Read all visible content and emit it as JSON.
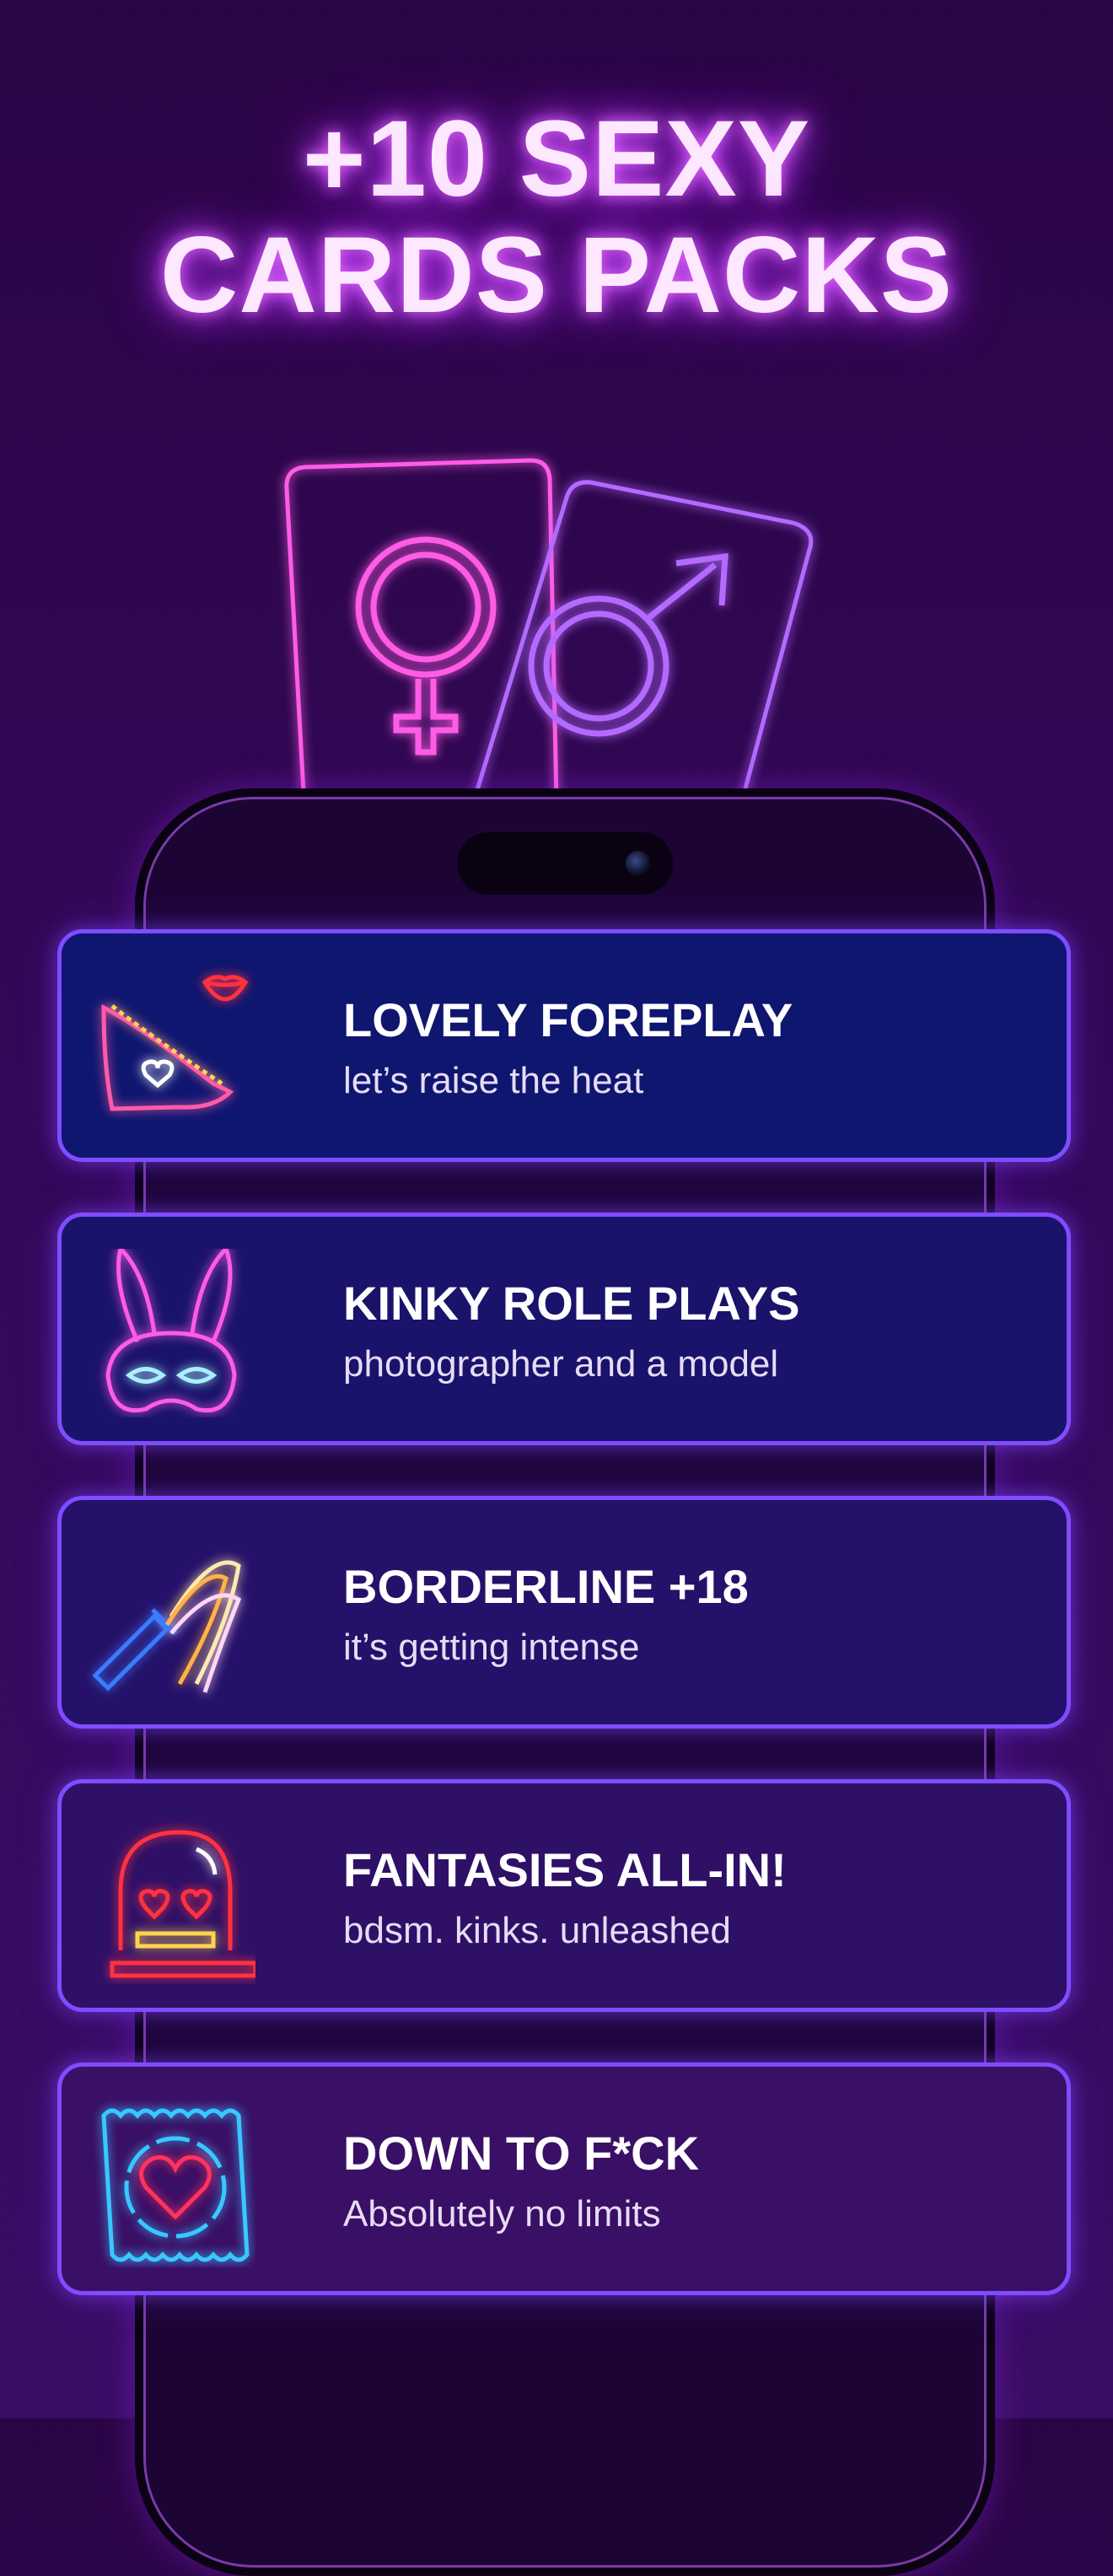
{
  "headline": {
    "line1": "+10 SEXY",
    "line2": "CARDS PACKS"
  },
  "hero": {
    "left_card_icon": "female-symbol-icon",
    "right_card_icon": "male-symbol-icon",
    "colors": {
      "pink": "#ff5be6",
      "violet": "#b46bff"
    }
  },
  "packs": [
    {
      "title": "LOVELY FOREPLAY",
      "subtitle": "let’s raise the heat",
      "icon": "panties-lips-icon",
      "bg": "#0f1670"
    },
    {
      "title": "KINKY ROLE PLAYS",
      "subtitle": "photographer and a model",
      "icon": "bunny-mask-icon",
      "bg": "#1a136b"
    },
    {
      "title": "BORDERLINE +18",
      "subtitle": "it’s getting intense",
      "icon": "whip-icon",
      "bg": "#25116a"
    },
    {
      "title": "FANTASIES ALL-IN!",
      "subtitle": "bdsm. kinks. unleashed",
      "icon": "in-love-ghost-icon",
      "bg": "#2e1067"
    },
    {
      "title": "DOWN TO F*CK",
      "subtitle": "Absolutely no limits",
      "icon": "condom-heart-icon",
      "bg": "#3a0f66"
    }
  ],
  "colors": {
    "card_border": "#7f4cff",
    "headline_glow": "#c23bff"
  }
}
